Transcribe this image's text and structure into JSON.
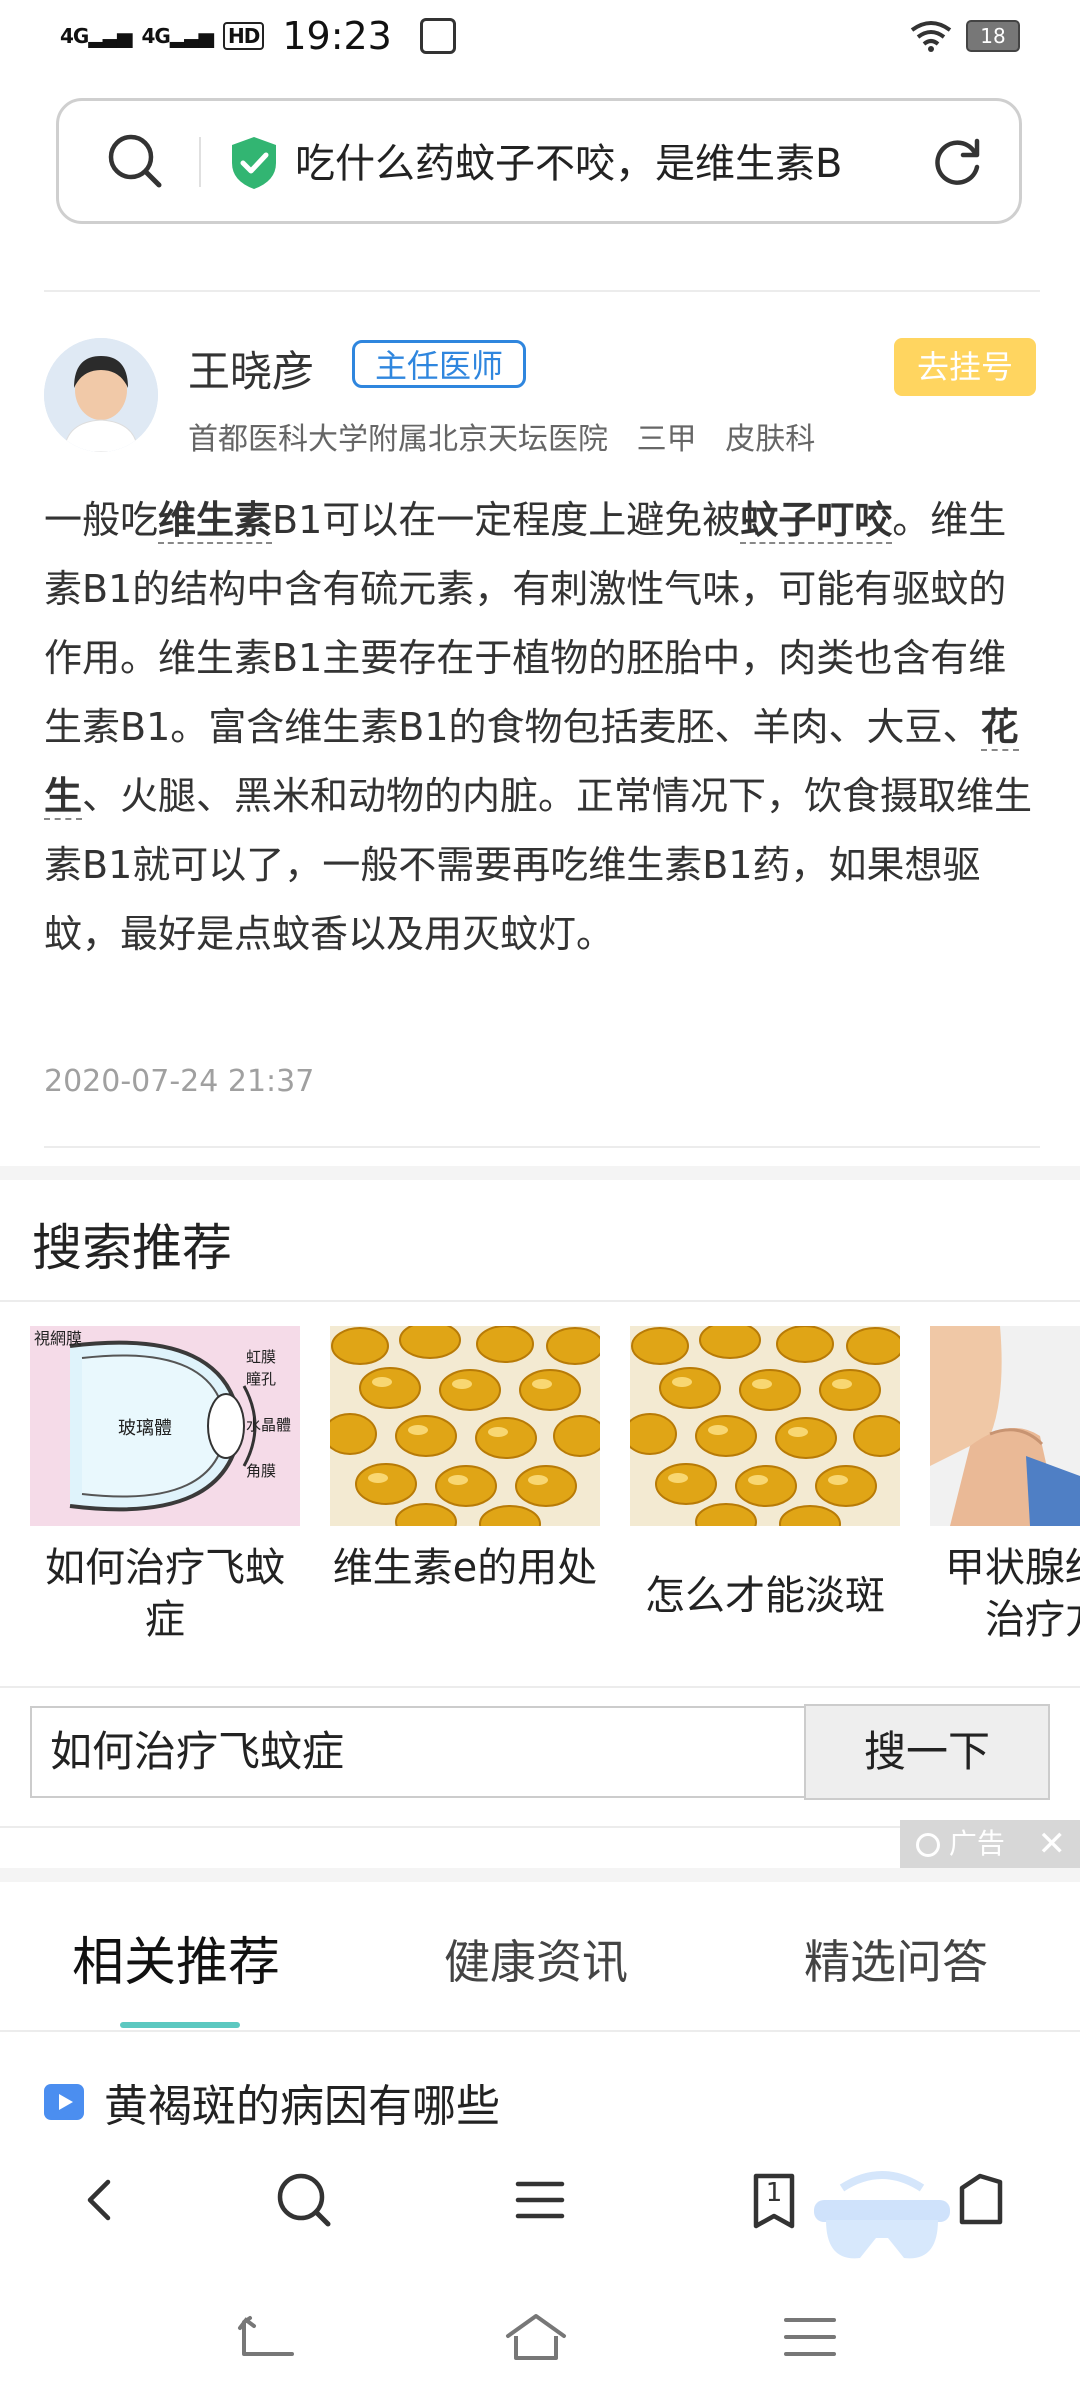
{
  "status_bar": {
    "network1": "4G",
    "network2": "4G",
    "hd": "HD",
    "time": "19:23",
    "battery": "18"
  },
  "search_bar": {
    "query": "吃什么药蚊子不咬，是维生素B"
  },
  "doctor": {
    "name": "王晓彦",
    "title": "主任医师",
    "hospital": "首都医科大学附属北京天坛医院",
    "level": "三甲",
    "department": "皮肤科",
    "register_label": "去挂号"
  },
  "answer": {
    "p1": "一般吃",
    "kw1": "维生素",
    "p2": "B1可以在一定程度上避免被",
    "kw2": "蚊子叮咬",
    "p3": "。维生素B1的结构中含有硫元素，有刺激性气味，可能有驱蚊的作用。维生素B1主要存在于植物的胚胎中，肉类也含有维生素B1。富含维生素B1的食物包括麦胚、羊肉、大豆、",
    "kw3": "花生",
    "p4": "、火腿、黑米和动物的内脏。正常情况下，饮食摄取维生素B1就可以了，一般不需要再吃维生素B1药，如果想驱蚊，最好是点蚊香以及用灭蚊灯。",
    "date": "2020-07-24 21:37"
  },
  "search_recommend": {
    "title": "搜索推荐",
    "cards": [
      {
        "label": "如何治疗飞蚊症",
        "img_labels": [
          "視網膜",
          "虹膜",
          "瞳孔",
          "水晶體",
          "角膜",
          "玻璃體"
        ]
      },
      {
        "label": "维生素e的用处"
      },
      {
        "label": "怎么才能淡斑"
      },
      {
        "label": "甲状腺结节的治疗方法"
      }
    ],
    "input_value": "如何治疗飞蚊症",
    "button_label": "搜一下",
    "ad_label": "广告"
  },
  "tabs": [
    {
      "label": "相关推荐",
      "active": true
    },
    {
      "label": "健康资讯",
      "active": false
    },
    {
      "label": "精选问答",
      "active": false
    }
  ],
  "news": [
    {
      "title": "黄褐斑的病因有哪些"
    }
  ],
  "browser_nav": {
    "tab_count": "1"
  },
  "colors": {
    "accent_blue": "#2f86de",
    "register_yellow": "#ffd560",
    "tab_underline": "#5cc8c0",
    "shield_green": "#32b572"
  }
}
